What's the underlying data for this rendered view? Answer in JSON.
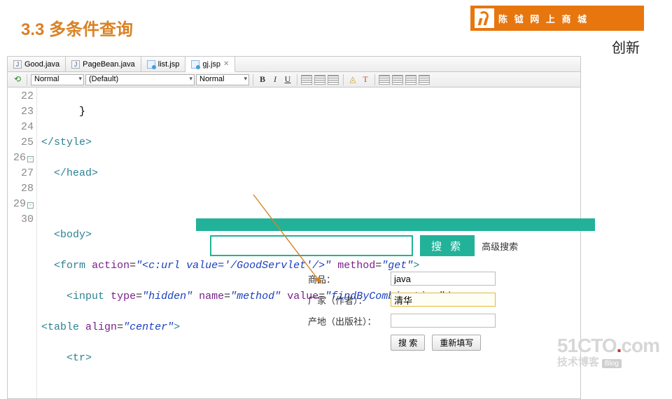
{
  "heading": "3.3 多条件查询",
  "brand_bar": "陈 钺 网 上 商 城",
  "top_right": "创新",
  "tabs": [
    {
      "label": "Good.java",
      "icon": "j",
      "active": false
    },
    {
      "label": "PageBean.java",
      "icon": "j",
      "active": false
    },
    {
      "label": "list.jsp",
      "icon": "jsp",
      "active": false
    },
    {
      "label": "gj.jsp",
      "icon": "jsp",
      "active": true
    }
  ],
  "toolbar": {
    "combo1": "Normal",
    "combo2": "(Default)",
    "combo3": "Normal"
  },
  "gutter": [
    "22",
    "23",
    "24",
    "25",
    "26",
    "27",
    "28",
    "29",
    "30"
  ],
  "code": {
    "l22": "      }",
    "l23a": "</style>",
    "l24a": "  </head>",
    "l26a": "  <body>",
    "l27": {
      "indent": "  ",
      "form": "form",
      "action_attr": "action",
      "action_val1": "\"<c:url value=",
      "action_val2": "'/GoodServlet'",
      "action_val3": "/>\"",
      "method_attr": "method",
      "method_val": "\"get\""
    },
    "l28": {
      "indent": "    ",
      "input": "input",
      "type_attr": "type",
      "type_val": "\"hidden\"",
      "name_attr": "name",
      "name_val": "\"method\"",
      "value_attr": "value",
      "value_val": "\"findByCombination\""
    },
    "l29": {
      "table": "table",
      "align_attr": "align",
      "align_val": "\"center\""
    },
    "l30": "    <tr>"
  },
  "search": {
    "button": "搜 索",
    "advanced": "高级搜索"
  },
  "form": {
    "f1_label": "商品：",
    "f1_value": "java",
    "f2_label": "厂家（作者）：",
    "f2_value": "清华",
    "f3_label": "产地（出版社）：",
    "f3_value": "",
    "submit": "搜    索",
    "reset": "重新填写"
  },
  "watermark": {
    "big1": "51CTO",
    "big2": ".",
    "big3": "com",
    "sub": "技术博客",
    "tag": "Blog"
  }
}
